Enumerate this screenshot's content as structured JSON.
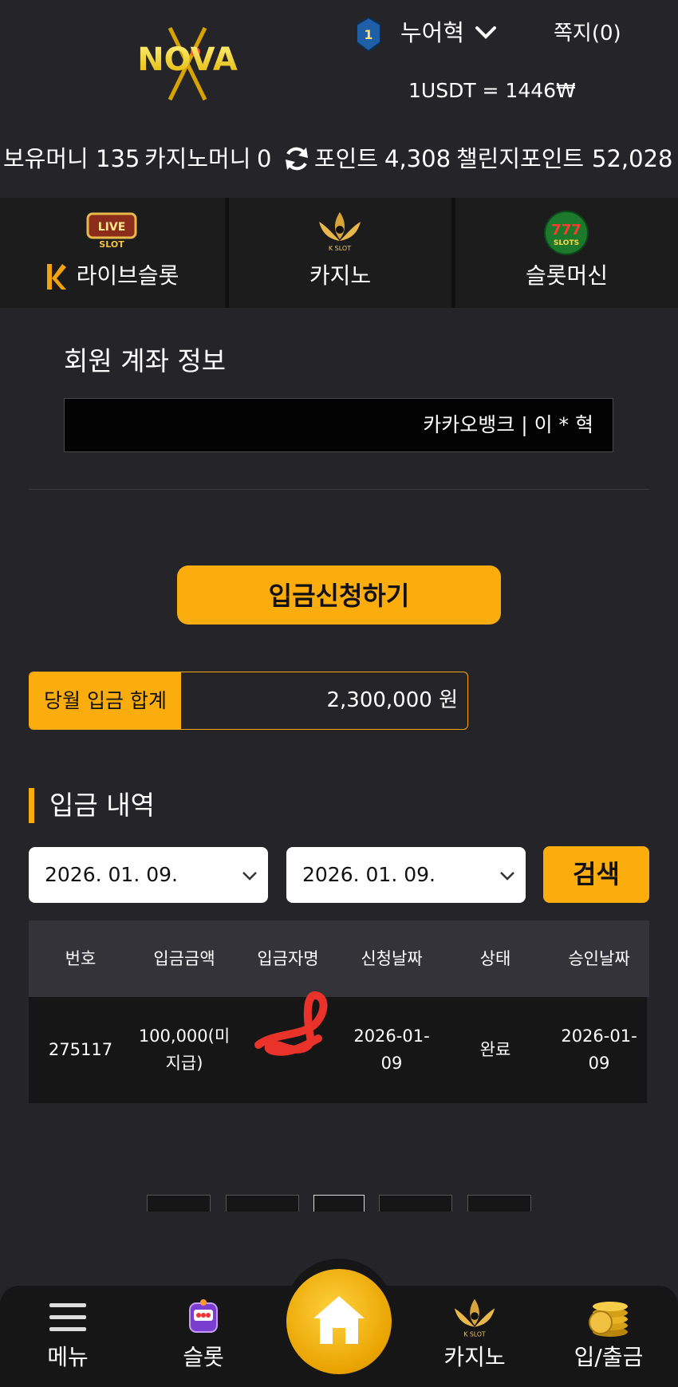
{
  "header": {
    "logo_text": "NOVA",
    "rank_level": "1",
    "username": "누어혁",
    "messages_label": "쪽지(0)",
    "exchange_rate": "1USDT = 1446₩"
  },
  "balances": {
    "cash_label": "보유머니",
    "cash_value": "135",
    "casino_label": "카지노머니",
    "casino_value": "0",
    "point_label": "포인트",
    "point_value": "4,308",
    "challenge_label": "챌린지포인트",
    "challenge_value": "52,028"
  },
  "categories": {
    "items": [
      {
        "label": "라이브슬롯",
        "icon": "live-slot-icon"
      },
      {
        "label": "카지노",
        "icon": "kslot-lotus-icon"
      },
      {
        "label": "슬롯머신",
        "icon": "777-slots-icon"
      }
    ],
    "live_badge_top": "LIVE",
    "live_badge_bottom": "SLOT",
    "kslot_text": "K SLOT",
    "slots_777": "777",
    "slots_text": "SLOTS"
  },
  "account": {
    "title": "회원 계좌 정보",
    "info": "카카오뱅크 | 이 * 혁"
  },
  "deposit": {
    "request_button": "입금신청하기",
    "monthly_label": "당월 입금 합계",
    "monthly_value": "2,300,000 원"
  },
  "history": {
    "title": "입금 내역",
    "date_from": "2026. 01. 09.",
    "date_to": "2026. 01. 09.",
    "search_button": "검색",
    "columns": [
      "번호",
      "입금금액",
      "입금자명",
      "신청날짜",
      "상태",
      "승인날짜"
    ],
    "rows": [
      {
        "no": "275117",
        "amount_l1": "100,000(미",
        "amount_l2": "지급)",
        "name": "",
        "req_l1": "2026-01-",
        "req_l2": "09",
        "status": "완료",
        "appr_l1": "2026-01-",
        "appr_l2": "09"
      }
    ]
  },
  "bottom_nav": {
    "menu": "메뉴",
    "slot": "슬롯",
    "home": "home",
    "casino": "카지노",
    "cash": "입/출금"
  },
  "colors": {
    "accent": "#fbad0e",
    "background": "#252428",
    "panel": "#161616"
  }
}
